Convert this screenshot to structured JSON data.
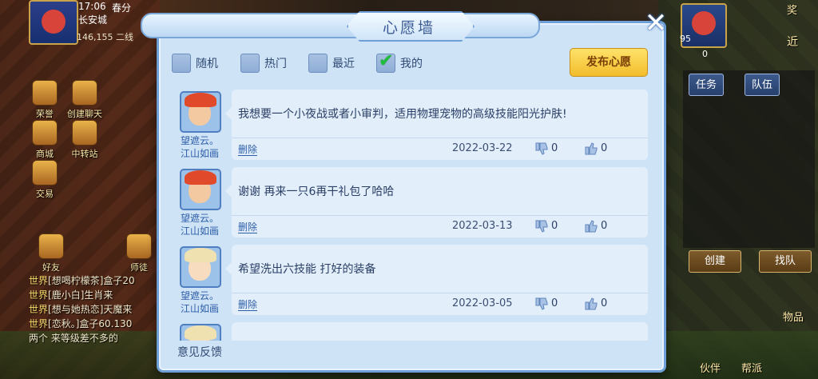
{
  "hud": {
    "time": "17:06",
    "season": "春分",
    "map_name": "长安城",
    "coordinates": "146,155 二线",
    "left_items": [
      "荣誉",
      "创建聊天",
      "商城",
      "中转站",
      "交易",
      "好友",
      "师徒"
    ],
    "right_level": "95",
    "right_value": "0",
    "right_near": "近",
    "right_mail": "奖",
    "team_tabs": [
      "任务",
      "队伍"
    ],
    "team_buttons": [
      "创建",
      "找队"
    ],
    "bottom_labels": [
      "伙伴",
      "帮派",
      "物品"
    ]
  },
  "chat": [
    {
      "tag": "世界",
      "text": "[想喝柠檬茶]盒子20"
    },
    {
      "tag": "世界",
      "text": "[鹿小白]生肖来"
    },
    {
      "tag": "世界",
      "text": "[想与她热恋]天魔来"
    },
    {
      "tag": "世界",
      "text": "[恋秋。]盒子60.130"
    },
    {
      "tag": "",
      "text": "两个 来等级差不多的"
    }
  ],
  "modal": {
    "title": "心愿墙",
    "close_label": "✕",
    "filters": [
      {
        "label": "随机",
        "checked": false
      },
      {
        "label": "热门",
        "checked": false
      },
      {
        "label": "最近",
        "checked": false
      },
      {
        "label": "我的",
        "checked": true
      }
    ],
    "publish_label": "发布心愿",
    "feedback_label": "意见反馈",
    "wishes": [
      {
        "author": "望遮云。\n江山如画",
        "author_line1": "望遮云。",
        "author_line2": "江山如画",
        "message": "我想要一个小夜战或者小审判，适用物理宠物的高级技能阳光护肤!",
        "delete_label": "删除",
        "date": "2022-03-22",
        "dislikes": "0",
        "likes": "0",
        "avatar": "red-hair"
      },
      {
        "author_line1": "望遮云。",
        "author_line2": "江山如画",
        "message": "谢谢 再来一只6再干礼包了哈哈",
        "delete_label": "删除",
        "date": "2022-03-13",
        "dislikes": "0",
        "likes": "0",
        "avatar": "red-hair"
      },
      {
        "author_line1": "望遮云。",
        "author_line2": "江山如画",
        "message": "希望洗出六技能 打好的装备",
        "delete_label": "删除",
        "date": "2022-03-05",
        "dislikes": "0",
        "likes": "0",
        "avatar": "blond-hair"
      },
      {
        "author_line1": "",
        "author_line2": "",
        "message": "",
        "delete_label": "",
        "date": "",
        "dislikes": "",
        "likes": "",
        "avatar": "blond-hair"
      }
    ]
  },
  "colors": {
    "modal_bg": "#cfe3f7",
    "modal_border": "#6e9fd6",
    "publish_button": "#f2bd2c",
    "check_green": "#1fbf3c",
    "author_blue": "#2d5ea8"
  }
}
